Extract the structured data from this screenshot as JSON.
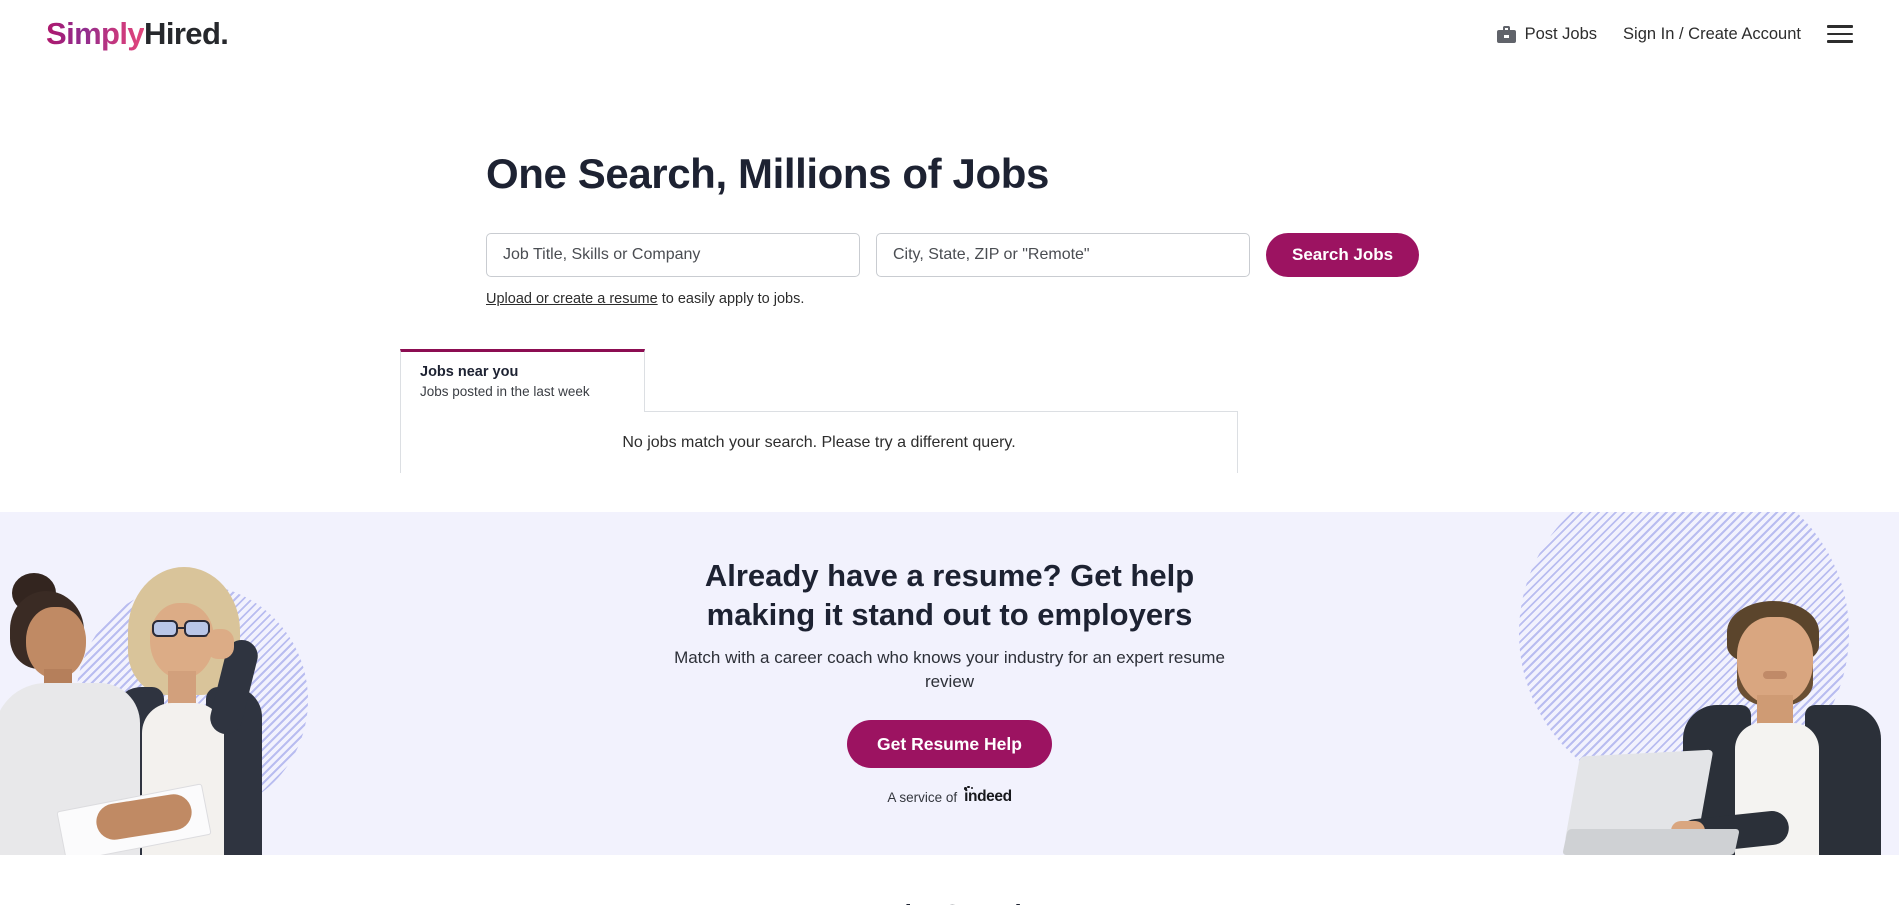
{
  "header": {
    "logo_simply": "Simply",
    "logo_hired": "Hired.",
    "post_jobs": "Post Jobs",
    "sign_in": "Sign In / Create Account",
    "menu_icon": "hamburger-menu-icon",
    "briefcase_icon": "briefcase-icon"
  },
  "hero": {
    "heading": "One Search, Millions of Jobs",
    "what_placeholder": "Job Title, Skills or Company",
    "what_value": "",
    "where_placeholder": "City, State, ZIP or \"Remote\"",
    "where_value": "",
    "search_button": "Search Jobs",
    "resume_link": "Upload or create a resume",
    "resume_rest": " to easily apply to jobs."
  },
  "tabs": {
    "active_title": "Jobs near you",
    "active_subtitle": "Jobs posted in the last week"
  },
  "results": {
    "empty_message": "No jobs match your search. Please try a different query."
  },
  "promo": {
    "heading": "Already have a resume? Get help making it stand out to employers",
    "subheading": "Match with a career coach who knows your industry for an expert resume review",
    "cta": "Get Resume Help",
    "service_of": "A service of",
    "indeed": "indeed"
  },
  "below_fold": {
    "clipped_heading": "Popular Searches"
  },
  "colors": {
    "brand_magenta": "#9c1361",
    "tab_accent": "#8c0d52",
    "promo_background": "#f2f2fd",
    "stripe_blue": "#b9bdf0",
    "heading_navy": "#1d2232"
  }
}
